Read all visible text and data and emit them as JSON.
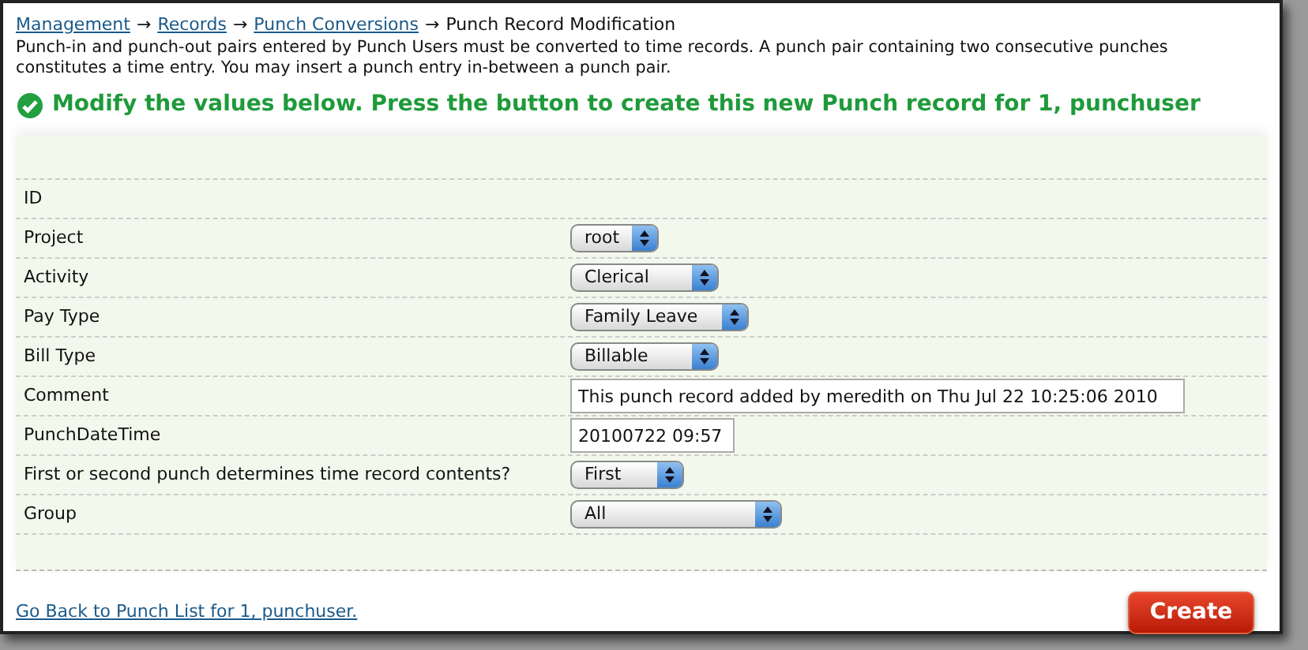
{
  "breadcrumb": [
    {
      "label": "Management",
      "kind": "link"
    },
    {
      "label": "→",
      "kind": "separator"
    },
    {
      "label": "Records",
      "kind": "link"
    },
    {
      "label": "→",
      "kind": "separator"
    },
    {
      "label": "Punch Conversions",
      "kind": "link"
    },
    {
      "label": "→",
      "kind": "separator"
    },
    {
      "label": "Punch Record Modification",
      "kind": "current"
    }
  ],
  "description": "Punch-in and punch-out pairs entered by Punch Users must be converted to time records. A punch pair containing two consecutive punches constitutes a time entry. You may insert a punch entry in-between a punch pair.",
  "message": "Modify the values below. Press the button to create this new Punch record for 1, punchuser",
  "fields": [
    {
      "label": "ID",
      "kind": "plain"
    },
    {
      "label": "Project",
      "kind": "select",
      "value": "root"
    },
    {
      "label": "Activity",
      "kind": "select",
      "value": "Clerical"
    },
    {
      "label": "Pay Type",
      "kind": "select",
      "value": "Family Leave"
    },
    {
      "label": "Bill Type",
      "kind": "select",
      "value": "Billable"
    },
    {
      "label": "Comment",
      "kind": "input",
      "value": "This punch record added by meredith on Thu Jul 22 10:25:06 2010"
    },
    {
      "label": "PunchDateTime",
      "kind": "input",
      "value": "20100722 09:57"
    },
    {
      "label": "First or second punch determines time record contents?",
      "kind": "select",
      "value": "First"
    },
    {
      "label": "Group",
      "kind": "select",
      "value": "All"
    }
  ],
  "back_link": "Go Back to Punch List for 1, punchuser.",
  "create_button": "Create"
}
